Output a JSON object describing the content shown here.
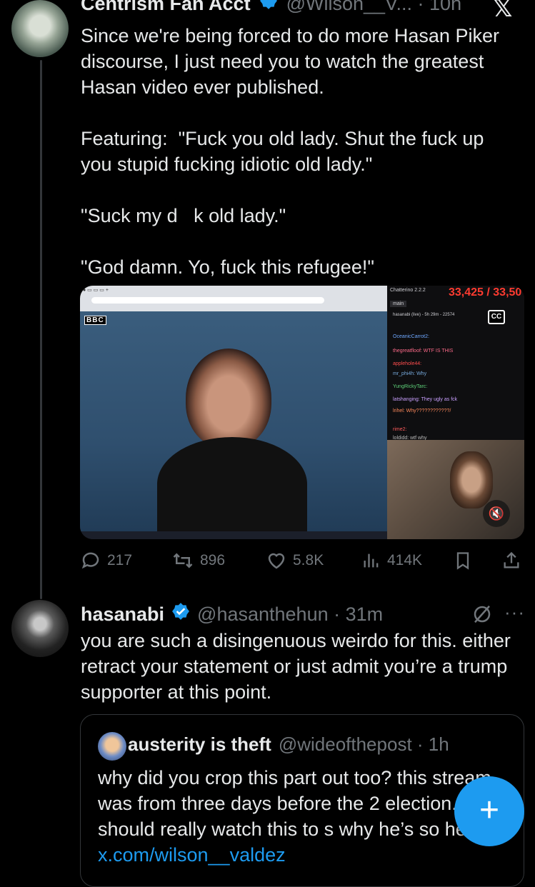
{
  "tweet": {
    "author_name": "Centrism Fan Acct",
    "handle_time": "@Wilson__V... · 10h",
    "text": "Since we're being forced to do more Hasan Piker discourse, I just need you to watch the greatest Hasan video ever published.\n\nFeaturing:  \"Fuck you old lady. Shut the fuck up you stupid fucking idiotic old lady.\"\n\n\"Suck my d   k old lady.\"\n\n\"God damn. Yo, fuck this refugee!\"",
    "media": {
      "bbc_label": "BBC",
      "chat_app": "Chatterino 2.2.2",
      "counter": "33,425 / 33,50",
      "chat_tab": "main",
      "chat_status": "hasanabi (live) - 5h 29m - 22574",
      "chat_messages": [
        "OceanicCarrot2:",
        "thegreatfloof:   WTF IS THIS",
        "applehole44:",
        "mr_phi4h: Why",
        "YungRickyTarc:",
        "latshanging: They ugly as fck",
        "lrihel: Why????????????/",
        "rime2:",
        "loldidd: wtf why"
      ],
      "cc_label": "CC"
    },
    "stats": {
      "replies": "217",
      "reposts": "896",
      "likes": "5.8K",
      "views": "414K"
    }
  },
  "reply": {
    "author_name": "hasanabi",
    "handle_time": "@hasanthehun · 31m",
    "text": "you are such a disingenuous weirdo for this. either retract your statement or just admit you’re a trump supporter at this point.",
    "more": "···"
  },
  "quote": {
    "author_name": "austerity is theft",
    "handle_time": "@wideofthepost · 1h",
    "text": "why did you crop this part out too? this stream was from three days before the 2 election. you should really watch this to s why he’s so heated",
    "link": "x.com/wilson__valdez"
  },
  "fab_label": "+",
  "colors": {
    "accent": "#1d9bf0",
    "muted": "#71767b",
    "text": "#e7e9ea",
    "background": "#000000"
  }
}
